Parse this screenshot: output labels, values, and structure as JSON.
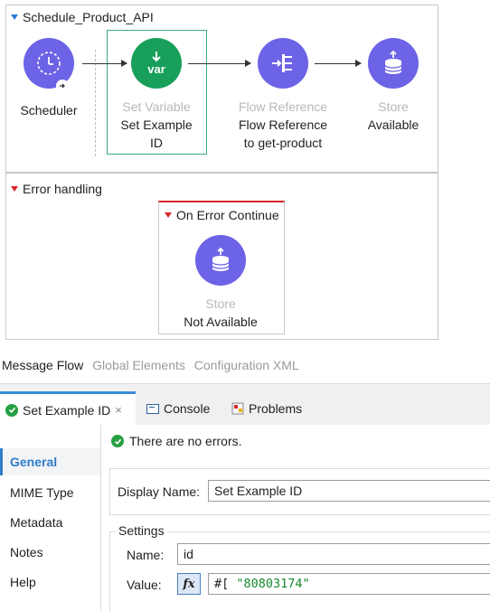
{
  "canvas": {
    "flow_name": "Schedule_Product_API",
    "nodes": [
      {
        "type": "",
        "name": "Scheduler",
        "icon": "clock-icon"
      },
      {
        "type": "Set Variable",
        "name": "Set Example ID",
        "icon": "var-icon"
      },
      {
        "type": "Flow Reference",
        "name": "Flow Reference to get-product",
        "icon": "flow-ref-icon"
      },
      {
        "type": "Store",
        "name": "Available",
        "icon": "store-icon"
      }
    ],
    "error_handling_label": "Error handling",
    "on_error": {
      "title": "On Error Continue",
      "node_type": "Store",
      "node_name": "Not Available",
      "icon": "store-icon"
    },
    "var_label": "var"
  },
  "editor_tabs": [
    "Message Flow",
    "Global Elements",
    "Configuration XML"
  ],
  "panel": {
    "tabs": [
      {
        "label": "Set Example ID",
        "icon": "check-icon"
      },
      {
        "label": "Console",
        "icon": "console-icon"
      },
      {
        "label": "Problems",
        "icon": "problems-icon"
      }
    ],
    "close_glyph": "×",
    "side_items": [
      "General",
      "MIME Type",
      "Metadata",
      "Notes",
      "Help"
    ],
    "status": "There are no errors.",
    "display_name_label": "Display Name:",
    "display_name_value": "Set Example ID",
    "settings_label": "Settings",
    "name_label": "Name:",
    "name_value": "id",
    "value_label": "Value:",
    "fx_label": "fx",
    "value_prefix": "#[ ",
    "value_string": "\"80803174\""
  },
  "colors": {
    "node_purple": "#6c63e6",
    "node_green": "#18a05a",
    "selection": "#3aa891",
    "error_red": "#d9262c",
    "link_blue": "#2f7cc9"
  }
}
